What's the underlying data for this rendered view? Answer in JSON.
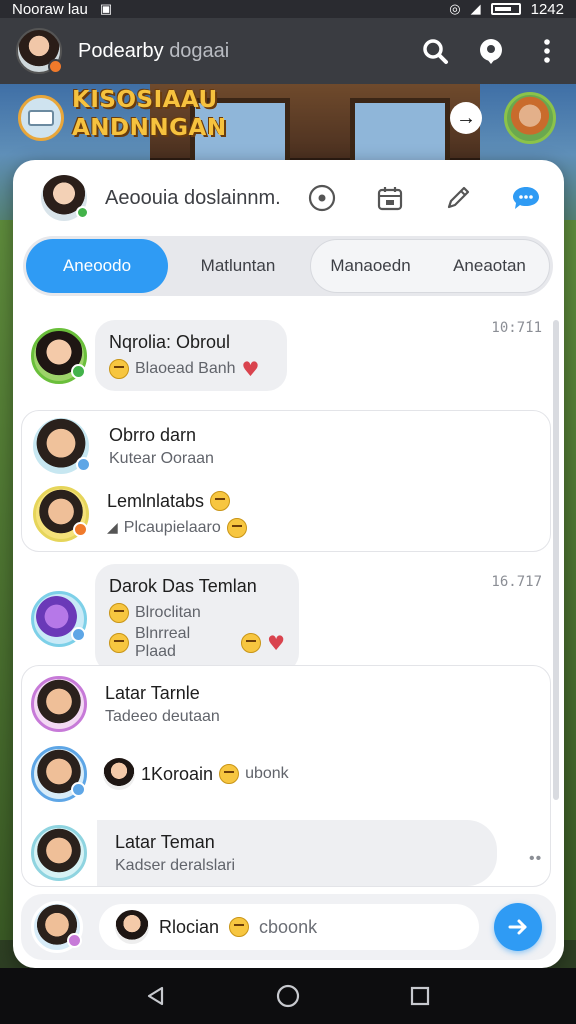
{
  "status_bar": {
    "left_text": "Nooraw lau",
    "time": "1242"
  },
  "app_bar": {
    "title_main": "Podearby",
    "title_muted": "dogaai",
    "icons": [
      "search-icon",
      "location-pin-icon",
      "more-vertical-icon"
    ]
  },
  "game_banner": {
    "title_line1": "KISOSIAAU",
    "title_line2": "ANDNNGAN",
    "arrow": "→"
  },
  "header": {
    "name": "Aeoouia doslainnm.",
    "icons": [
      "compass-icon",
      "calendar-icon",
      "pencil-icon",
      "chat-bubble-icon"
    ]
  },
  "tabs": {
    "active": "Aneoodo",
    "second": "Matluntan",
    "third": "Manaoedn",
    "fourth": "Aneaotan"
  },
  "conversations": [
    {
      "name": "Nqrolia: Obroul",
      "preview": "Blaoead Banh",
      "time": "10:7́11"
    },
    {
      "name": "Obrro darn",
      "preview": "Kutear Ooraan"
    },
    {
      "name": "Lemlnlatabs",
      "preview": "Plcaupielaaro"
    },
    {
      "name": "Darok Das Temlan",
      "preview_1": "Blroclitan",
      "preview_2": "Blnrreal Plaad",
      "time": "16.717"
    },
    {
      "name": "Latar Tarnle",
      "preview": "Tadeeo deutaan"
    },
    {
      "name": "1Koroain",
      "preview": "ubonk"
    },
    {
      "name": "Latar Teman",
      "preview": "Kadser deralslari"
    }
  ],
  "more_indicator": "••",
  "composer": {
    "name": "Rlocian",
    "placeholder": "cboonk"
  },
  "nav": [
    "back-icon",
    "home-icon",
    "recents-icon"
  ]
}
